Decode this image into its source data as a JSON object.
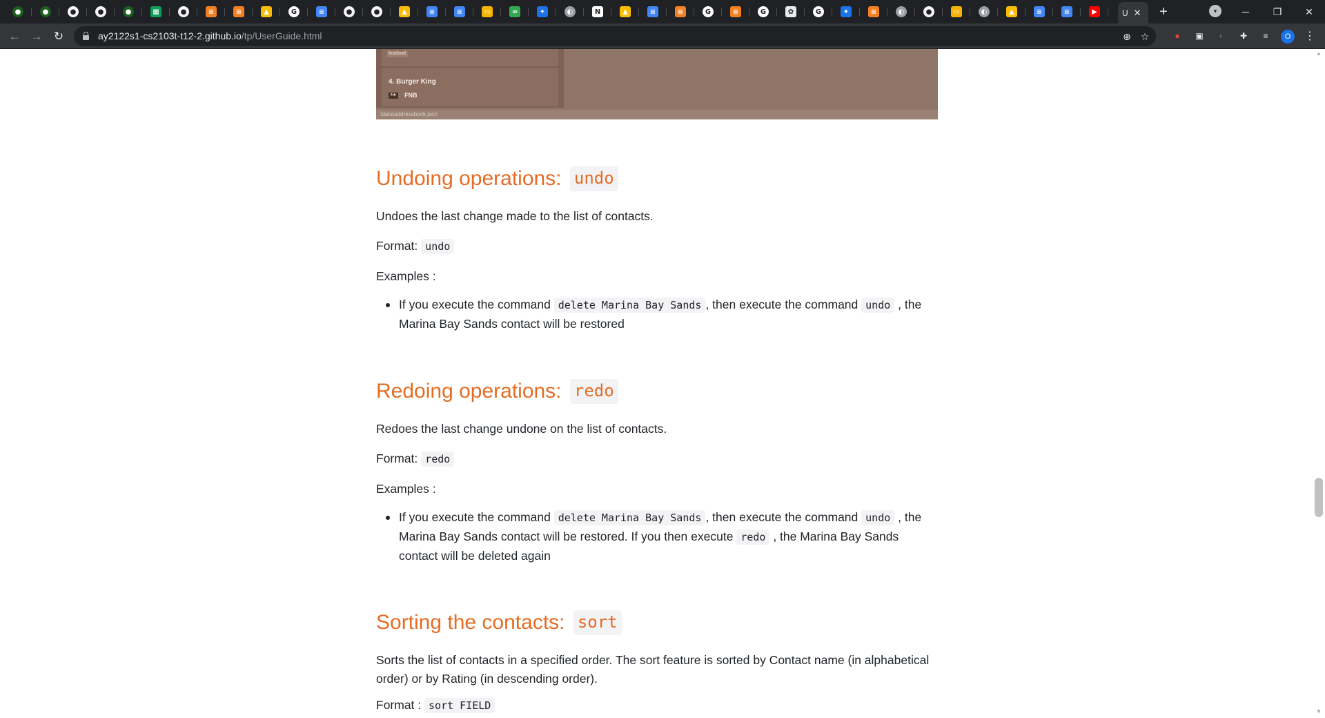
{
  "browser": {
    "active_tab_label": "U",
    "url_host": "ay2122s1-cs2103t-t12-2.github.io",
    "url_path": "/tp/UserGuide.html",
    "profile_initial": "O",
    "tab_icons": [
      "nus-icon",
      "nus-icon",
      "github-icon",
      "github-icon",
      "nus-icon",
      "sheets-icon",
      "github-icon",
      "stackoverflow-icon",
      "stackoverflow-icon",
      "drive-icon",
      "google-icon",
      "docs-icon",
      "github-icon",
      "github-icon",
      "drive-icon",
      "docs-icon",
      "docs-icon",
      "slides-icon",
      "link-icon",
      "extension-icon",
      "circle-icon",
      "notion-icon",
      "drive-icon",
      "docs-icon",
      "stackoverflow-icon",
      "google-icon",
      "stackoverflow-icon",
      "google-icon",
      "openai-icon",
      "google-icon",
      "extension-icon",
      "stackoverflow-icon",
      "circle-icon",
      "github-icon",
      "slides-icon",
      "circle-icon",
      "drive-icon",
      "docs-icon",
      "docs-icon",
      "youtube-icon"
    ]
  },
  "screenshot": {
    "tag_label": "fastfood",
    "contact_name": "4.  Burger King",
    "rating_badge": "4★",
    "category": "FNB",
    "status_path": ".\\data\\addressbook.json"
  },
  "undo": {
    "heading": "Undoing operations:",
    "heading_code": "undo",
    "description": "Undoes the last change made to the list of contacts.",
    "format_label": "Format:",
    "format_code": "undo",
    "examples_label": "Examples :",
    "example_part1": "If you execute the command",
    "example_code1": "delete Marina Bay Sands",
    "example_part2": ", then execute the command",
    "example_code2": "undo",
    "example_part3": ", the Marina Bay Sands contact will be restored"
  },
  "redo": {
    "heading": "Redoing operations:",
    "heading_code": "redo",
    "description": "Redoes the last change undone on the list of contacts.",
    "format_label": "Format:",
    "format_code": "redo",
    "examples_label": "Examples :",
    "example_part1": "If you execute the command",
    "example_code1": "delete Marina Bay Sands",
    "example_part2": ", then execute the command",
    "example_code2": "undo",
    "example_part3": ", the Marina Bay Sands contact will be restored. If you then execute",
    "example_code3": "redo",
    "example_part4": ", the Marina Bay Sands contact will be deleted again"
  },
  "sort": {
    "heading": "Sorting the contacts:",
    "heading_code": "sort",
    "description": "Sorts the list of contacts in a specified order. The sort feature is sorted by Contact name (in alphabetical order) or by Rating (in descending order).",
    "format_label": "Format :",
    "format_code": "sort FIELD"
  },
  "colors": {
    "heading": "#e46c24",
    "code_bg": "#f3f2f4",
    "text": "#212529"
  }
}
